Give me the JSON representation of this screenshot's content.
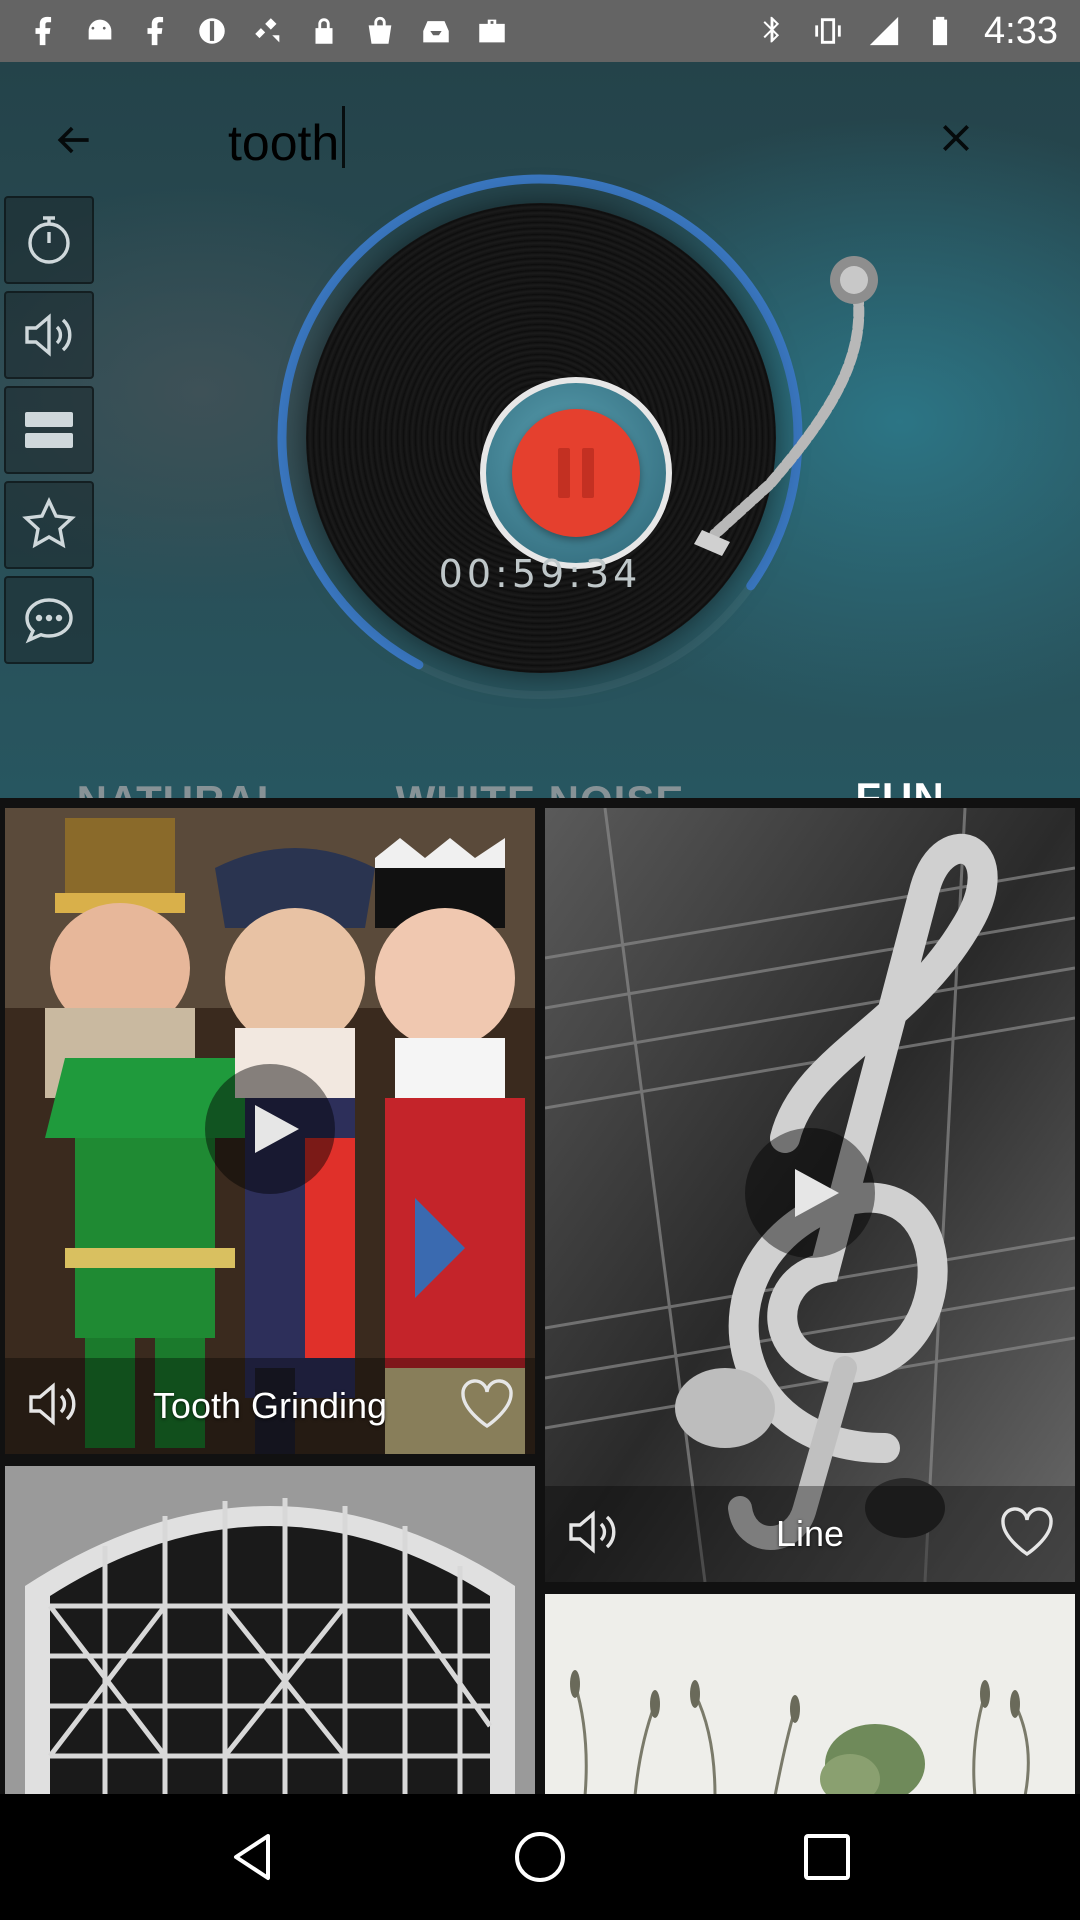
{
  "status_bar": {
    "time": "4:33",
    "left_icons": [
      "facebook-icon",
      "android-icon",
      "facebook-icon",
      "nfc-icon",
      "satellite-icon",
      "lock-icon",
      "bag-icon",
      "inbox-icon",
      "briefcase-icon"
    ],
    "right_icons": [
      "bluetooth-icon",
      "vibrate-icon",
      "signal-icon",
      "battery-icon"
    ]
  },
  "header": {
    "search_value": "tooth",
    "back_icon": "arrow-left-icon",
    "close_icon": "close-icon"
  },
  "side_tools": [
    {
      "name": "timer",
      "icon": "stopwatch-icon"
    },
    {
      "name": "volume",
      "icon": "speaker-icon"
    },
    {
      "name": "menu",
      "icon": "list-icon"
    },
    {
      "name": "favorites",
      "icon": "star-icon"
    },
    {
      "name": "chat",
      "icon": "chat-icon"
    }
  ],
  "player": {
    "timer": "00:59:34",
    "state": "playing",
    "progress": 0.77
  },
  "tabs": [
    {
      "label": "NATURAL",
      "active": false
    },
    {
      "label": "WHITE NOISE",
      "active": false
    },
    {
      "label": "FUN",
      "active": true
    }
  ],
  "sounds": [
    {
      "title": "Tooth Grinding"
    },
    {
      "title": "Line"
    }
  ],
  "colors": {
    "accent": "#4bb3c4",
    "pause_button": "#e5402e",
    "ring": "#3a77c0"
  }
}
